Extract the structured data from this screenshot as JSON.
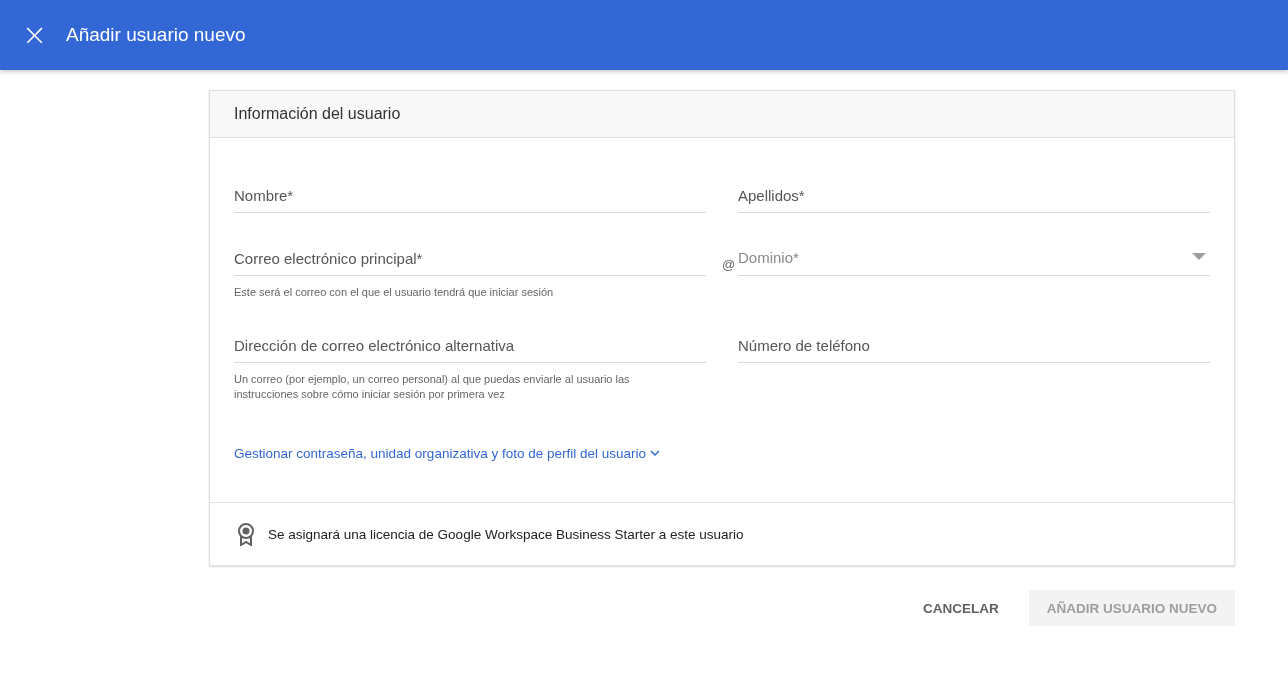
{
  "header": {
    "close_icon": "×",
    "title": "Añadir usuario nuevo"
  },
  "card": {
    "title": "Información del usuario",
    "fields": [
      {
        "kind": "text",
        "placeholder": "Nombre*"
      },
      {
        "kind": "text",
        "placeholder": "Apellidos*"
      },
      {
        "kind": "text",
        "placeholder": "Correo electrónico principal*",
        "hint": "Este será el correo con el que el usuario tendrá que iniciar sesión"
      },
      {
        "kind": "select",
        "prefix": "@",
        "placeholder": "Dominio*"
      },
      {
        "kind": "text",
        "placeholder": "Dirección de correo electrónico alternativa",
        "hint": "Un correo (por ejemplo, un correo personal) al que puedas enviarle al usuario las instrucciones sobre cómo iniciar sesión por primera vez"
      },
      {
        "kind": "text",
        "placeholder": "Número de teléfono"
      }
    ],
    "link": "Gestionar contraseña, unidad organizativa y foto de perfil del usuario",
    "license_note": "Se asignará una licencia de Google Workspace Business Starter a este usuario"
  },
  "buttons": [
    {
      "label": "CANCELAR",
      "kind": "text",
      "disabled": false
    },
    {
      "label": "AÑADIR USUARIO NUEVO",
      "kind": "filled",
      "disabled": true
    }
  ]
}
